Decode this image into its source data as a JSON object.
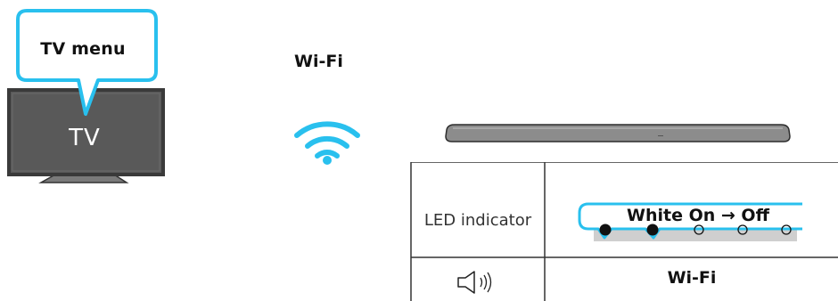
{
  "tv": {
    "callout_label": "TV menu",
    "screen_label": "TV"
  },
  "connection": {
    "label": "Wi-Fi"
  },
  "table": {
    "led_row_label": "LED indicator",
    "led_callout": "White On → Off",
    "led_states": [
      "on",
      "on",
      "off",
      "off",
      "off"
    ],
    "mode_row_label": "Wi-Fi"
  },
  "colors": {
    "accent": "#29c0ee",
    "tv_screen": "#595959",
    "led_strip": "#cfcfcf",
    "soundbar": "#8c8c8c"
  },
  "icons": [
    "wifi-icon",
    "speaker-icon",
    "tv-icon",
    "soundbar-icon"
  ]
}
